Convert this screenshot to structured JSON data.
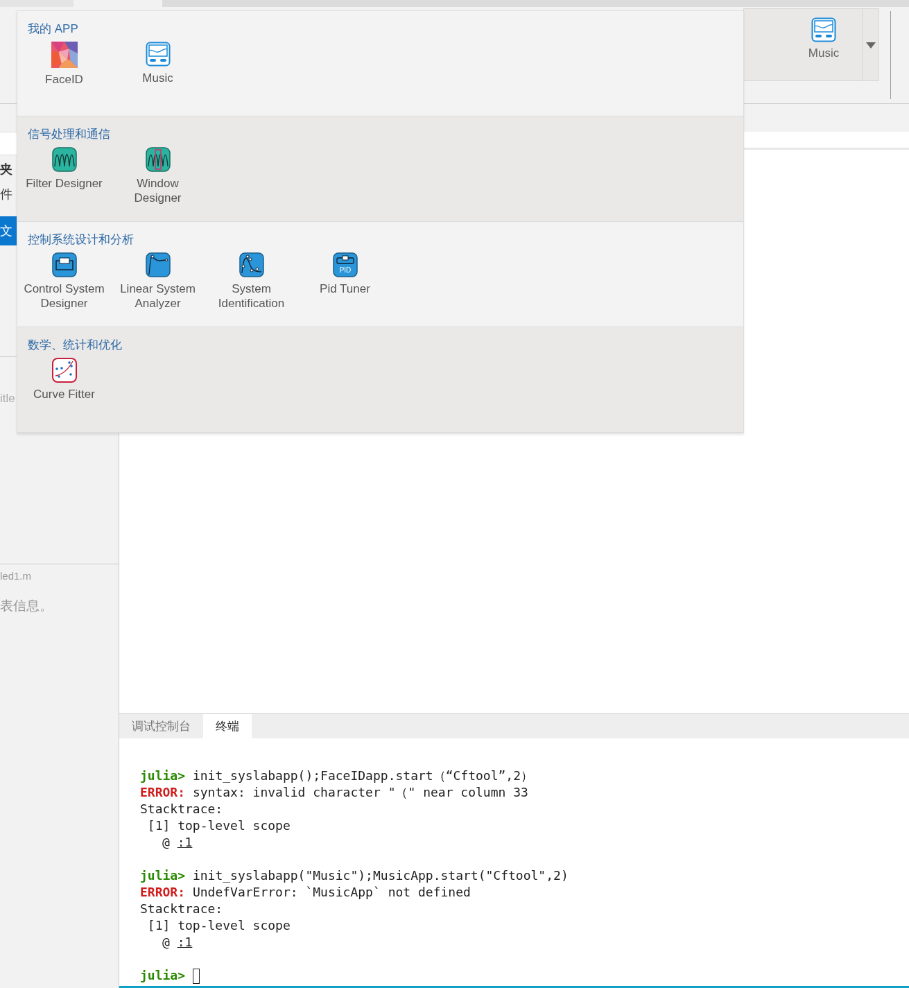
{
  "gallery": {
    "items": [
      {
        "label": "Music",
        "kind": "monitor"
      }
    ]
  },
  "sidebar": {
    "items": [
      {
        "label": "夹",
        "selected": false
      },
      {
        "label": "件",
        "selected": false
      },
      {
        "label": "文",
        "selected": true
      }
    ],
    "file_title": "itle",
    "file_name": "led1.m",
    "info": "表信息。"
  },
  "app_menu": {
    "sections": [
      {
        "title": "我的 APP",
        "apps": [
          {
            "label": "FaceID",
            "kind": "mosaic"
          },
          {
            "label": "Music",
            "kind": "monitor"
          }
        ]
      },
      {
        "title": "信号处理和通信",
        "apps": [
          {
            "label": "Filter Designer",
            "kind": "filter"
          },
          {
            "label": "Window Designer",
            "kind": "window"
          }
        ]
      },
      {
        "title": "控制系统设计和分析",
        "apps": [
          {
            "label": "Control System Designer",
            "kind": "control"
          },
          {
            "label": "Linear System Analyzer",
            "kind": "analyzer"
          },
          {
            "label": "System Identification",
            "kind": "ident"
          },
          {
            "label": "Pid Tuner",
            "kind": "pid",
            "icon_text": "PID"
          }
        ]
      },
      {
        "title": "数学、统计和优化",
        "apps": [
          {
            "label": "Curve Fitter",
            "kind": "curve"
          }
        ]
      }
    ]
  },
  "panel_tabs": [
    {
      "label": "调试控制台",
      "selected": false
    },
    {
      "label": "终端",
      "selected": true
    }
  ],
  "terminal": {
    "lines": [
      {
        "kind": "prompt",
        "prompt": "julia>",
        "text": "init_syslabapp();FaceIDapp.start（“Cftool”,2）"
      },
      {
        "kind": "error",
        "label": "ERROR:",
        "text": "syntax: invalid character \"（\" near column 33"
      },
      {
        "kind": "plain",
        "text": "Stacktrace:"
      },
      {
        "kind": "plain",
        "text": " [1] top-level scope"
      },
      {
        "kind": "location",
        "at": "@",
        "link": ":1"
      },
      {
        "kind": "blank"
      },
      {
        "kind": "prompt",
        "prompt": "julia>",
        "text": "init_syslabapp(\"Music\");MusicApp.start(\"Cftool\",2)"
      },
      {
        "kind": "error",
        "label": "ERROR:",
        "text": "UndefVarError: `MusicApp` not defined"
      },
      {
        "kind": "plain",
        "text": "Stacktrace:"
      },
      {
        "kind": "plain",
        "text": " [1] top-level scope"
      },
      {
        "kind": "location",
        "at": "@",
        "link": ":1"
      },
      {
        "kind": "blank"
      },
      {
        "kind": "input",
        "prompt": "julia>"
      }
    ]
  }
}
